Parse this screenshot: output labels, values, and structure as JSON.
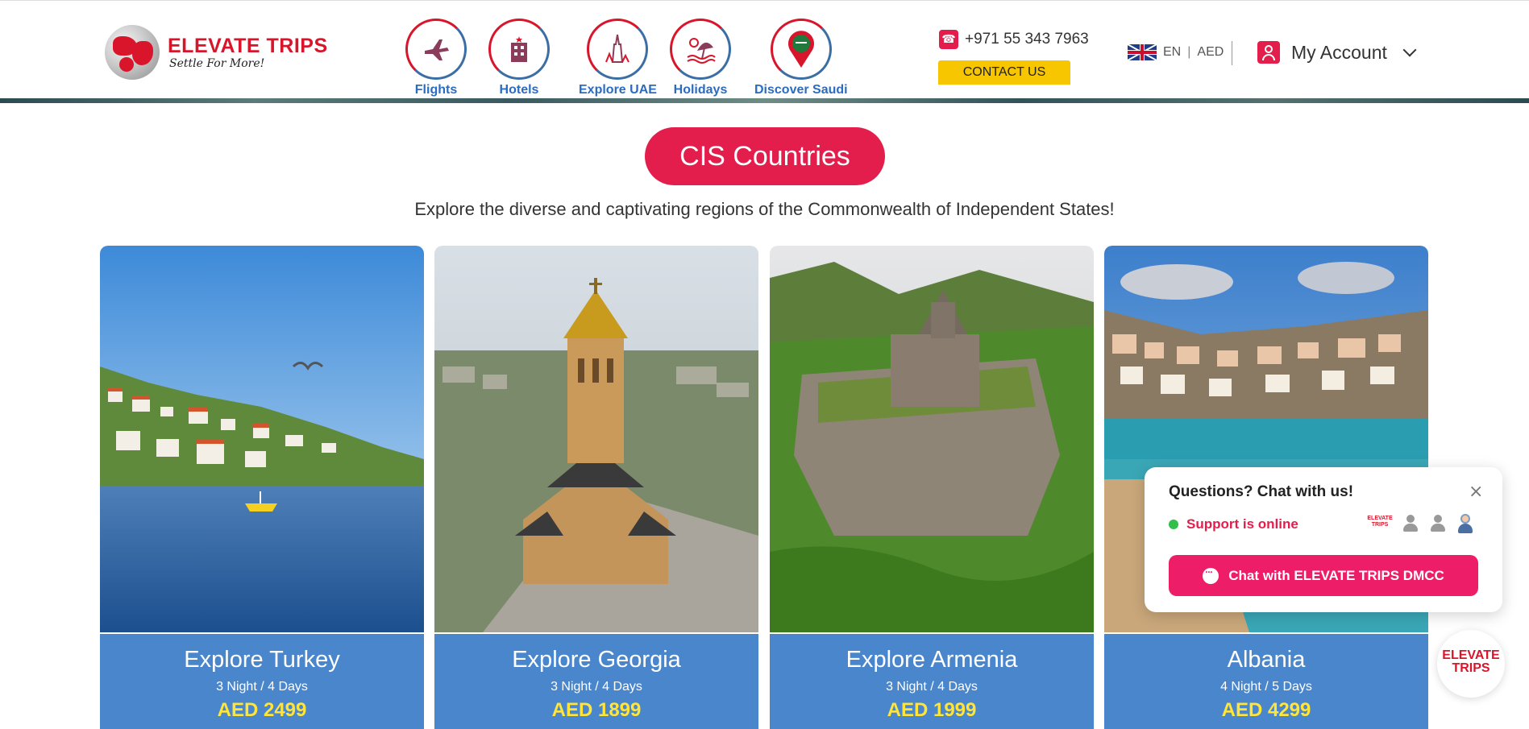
{
  "header": {
    "logo": {
      "name": "ELEVATE TRIPS",
      "tagline": "Settle For More!"
    },
    "nav": [
      {
        "label": "Flights",
        "icon": "airplane-icon"
      },
      {
        "label": "Hotels",
        "icon": "hotel-icon"
      },
      {
        "label": "Explore UAE",
        "icon": "burj-khalifa-icon"
      },
      {
        "label": "Holidays",
        "icon": "beach-umbrella-icon"
      },
      {
        "label": "Discover Saudi",
        "icon": "saudi-location-pin-icon"
      }
    ],
    "phone": "+971 55 343 7963",
    "contact_label": "CONTACT US",
    "language": "EN",
    "currency": "AED",
    "account_label": "My Account"
  },
  "section": {
    "title": "CIS Countries",
    "subtitle": "Explore the diverse and captivating regions of the Commonwealth of Independent States!"
  },
  "cards": [
    {
      "title": "Explore Turkey",
      "duration": "3 Night / 4 Days",
      "price": "AED 2499"
    },
    {
      "title": "Explore Georgia",
      "duration": "3 Night / 4 Days",
      "price": "AED 1899"
    },
    {
      "title": "Explore Armenia",
      "duration": "3 Night / 4 Days",
      "price": "AED 1999"
    },
    {
      "title": "Albania",
      "duration": "4 Night / 5 Days",
      "price": "AED 4299"
    }
  ],
  "chat": {
    "title": "Questions? Chat with us!",
    "status": "Support is online",
    "button_label": "Chat with ELEVATE TRIPS DMCC",
    "agent_logo": "ELEVATE TRIPS",
    "close": "×"
  },
  "floating_logo": "ELEVATE TRIPS",
  "colors": {
    "brand_red": "#e31e4c",
    "nav_blue": "#2b6cc0",
    "card_blue": "#4a86cc",
    "contact_yellow": "#f7c600"
  }
}
